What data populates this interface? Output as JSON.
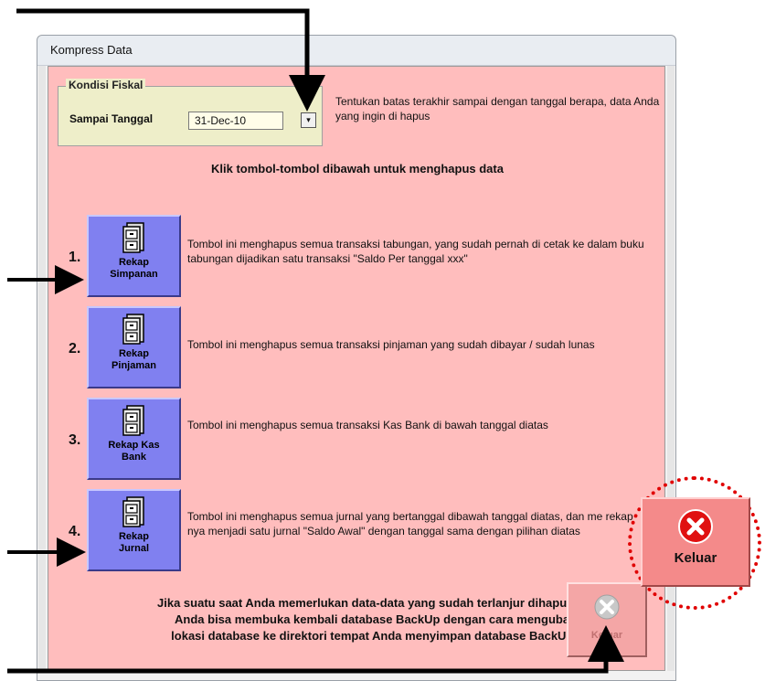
{
  "window": {
    "title": "Kompress Data"
  },
  "fiscal": {
    "legend": "Kondisi Fiskal",
    "label": "Sampai Tanggal",
    "date_value": "31-Dec-10",
    "dropdown_glyph": "▾",
    "hint": "Tentukan batas terakhir sampai dengan tanggal berapa, data Anda yang ingin di hapus"
  },
  "headline": "Klik tombol-tombol dibawah untuk menghapus data",
  "actions": [
    {
      "number": "1.",
      "label_line1": "Rekap",
      "label_line2": "Simpanan",
      "description": "Tombol ini menghapus semua transaksi tabungan, yang sudah pernah di cetak ke dalam buku tabungan dijadikan satu transaksi \"Saldo Per  tanggal  xxx\""
    },
    {
      "number": "2.",
      "label_line1": "Rekap",
      "label_line2": "Pinjaman",
      "description": "Tombol ini menghapus semua transaksi pinjaman yang sudah dibayar / sudah lunas"
    },
    {
      "number": "3.",
      "label_line1": "Rekap Kas",
      "label_line2": "Bank",
      "description": "Tombol ini menghapus semua transaksi Kas Bank di bawah tanggal diatas"
    },
    {
      "number": "4.",
      "label_line1": "Rekap",
      "label_line2": "Jurnal",
      "description": "Tombol ini menghapus semua jurnal yang bertanggal dibawah tanggal diatas, dan me rekap nya menjadi satu jurnal \"Saldo Awal\" dengan tanggal sama dengan pilihan diatas"
    }
  ],
  "footer_note": "Jika suatu saat Anda memerlukan data-data yang sudah terlanjur dihapus, Anda bisa membuka kembali database BackUp dengan cara mengubah lokasi database ke direktori tempat Anda menyimpan database BackUp.",
  "exit_button": {
    "label": "Keluar"
  },
  "exit_zoom": {
    "label": "Keluar"
  },
  "colors": {
    "client_bg": "#ffbdbd",
    "action_button": "#8080f0",
    "fiscal_bg": "#eeeec9",
    "exit_icon": "#e01010",
    "annotation": "#000000",
    "highlight_ring": "#e00000"
  },
  "icons": {
    "action": "file-cabinet-icon",
    "exit": "close-circle-icon"
  }
}
